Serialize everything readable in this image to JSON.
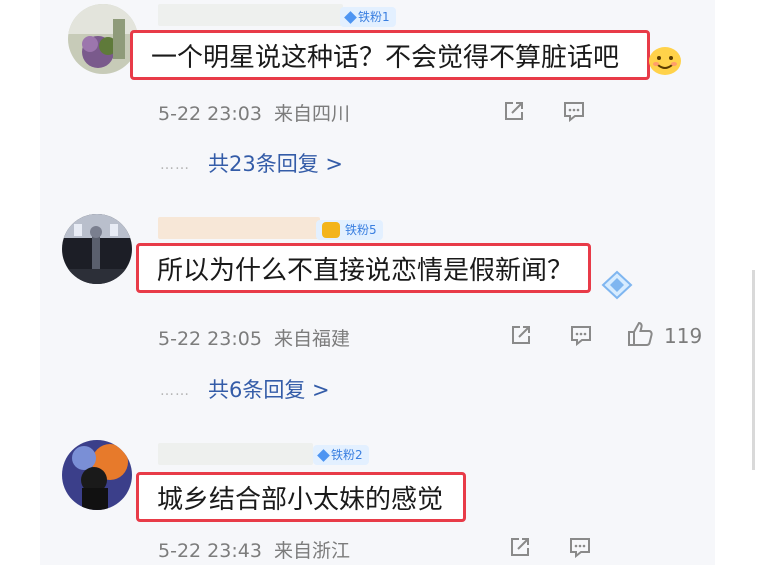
{
  "comments": [
    {
      "badge_label": "铁粉1",
      "text": "一个明星说这种话？不会觉得不算脏话吧",
      "time": "5-22 23:03",
      "location": "来自四川",
      "reply_dots": "……",
      "replies": "共23条回复 >",
      "icons": [
        "share-icon",
        "comment-icon"
      ]
    },
    {
      "badge_label": "铁粉5",
      "text": "所以为什么不直接说恋情是假新闻？",
      "time": "5-22 23:05",
      "location": "来自福建",
      "reply_dots": "……",
      "replies": "共6条回复 >",
      "likes": "119",
      "icons": [
        "share-icon",
        "comment-icon",
        "thumbs-up-icon"
      ]
    },
    {
      "badge_label": "铁粉2",
      "text": "城乡结合部小太妹的感觉",
      "time": "5-22 23:43",
      "location": "来自浙江",
      "icons": [
        "share-icon",
        "comment-icon"
      ]
    }
  ],
  "colors": {
    "highlight_border": "#e83b48",
    "reply_link": "#345ca8",
    "meta_text": "#7c7c7c",
    "badge_text": "#3a7fe0"
  }
}
